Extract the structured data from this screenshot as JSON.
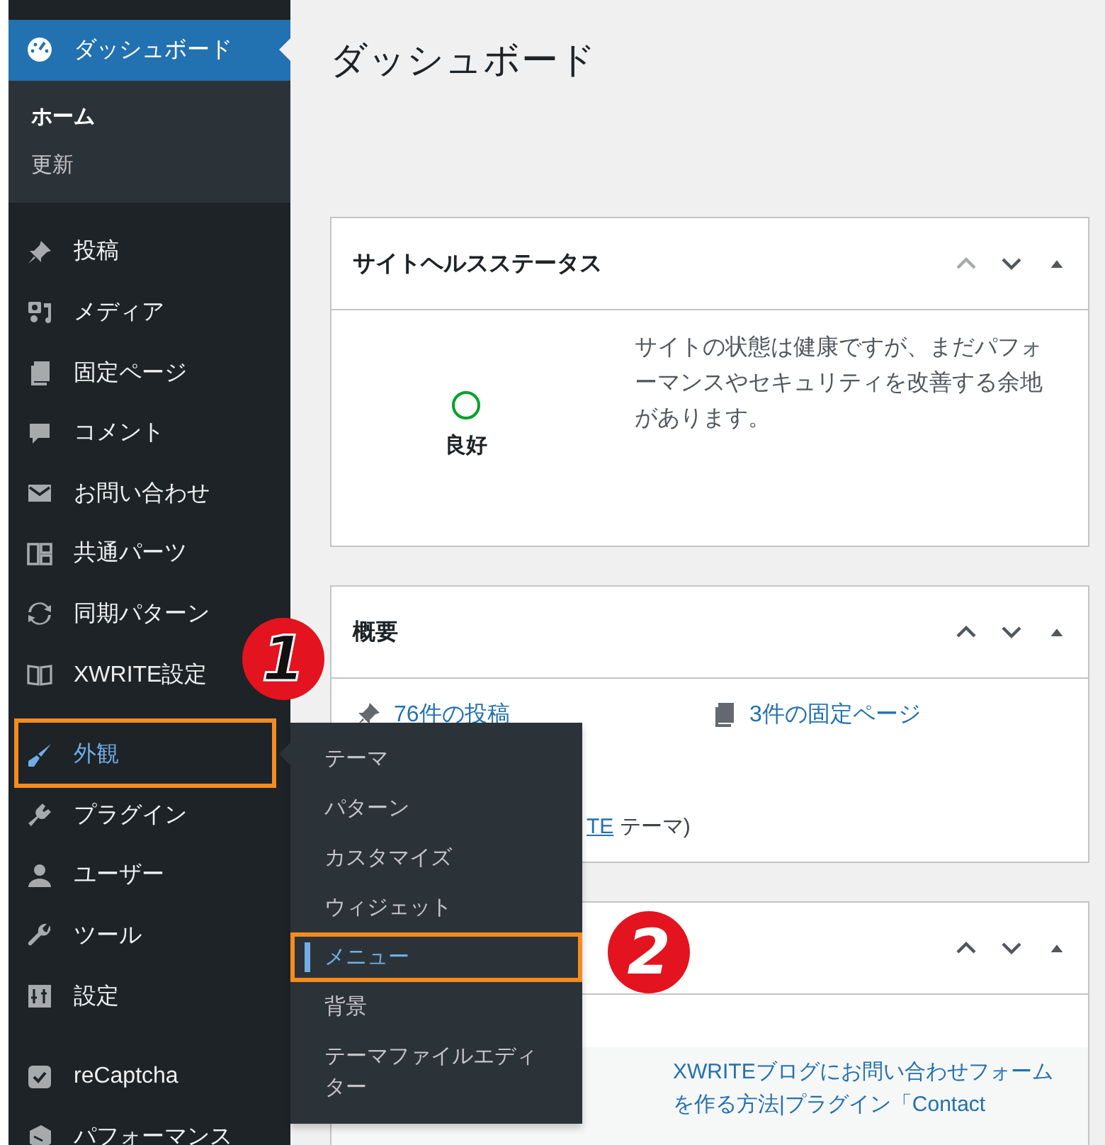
{
  "sidebar": {
    "groups": [
      [
        {
          "label": "ダッシュボード",
          "selected": true,
          "open": false,
          "highlighted": false,
          "submenu": [
            {
              "label": "ホーム",
              "selected": true
            },
            {
              "label": "更新",
              "selected": false
            }
          ]
        }
      ],
      [
        {
          "label": "投稿",
          "selected": false,
          "open": false,
          "highlighted": false
        },
        {
          "label": "メディア",
          "selected": false,
          "open": false,
          "highlighted": false
        },
        {
          "label": "固定ページ",
          "selected": false,
          "open": false,
          "highlighted": false
        },
        {
          "label": "コメント",
          "selected": false,
          "open": false,
          "highlighted": false
        },
        {
          "label": "お問い合わせ",
          "selected": false,
          "open": false,
          "highlighted": false
        },
        {
          "label": "共通パーツ",
          "selected": false,
          "open": false,
          "highlighted": false
        },
        {
          "label": "同期パターン",
          "selected": false,
          "open": false,
          "highlighted": false
        },
        {
          "label": "XWRITE設定",
          "selected": false,
          "open": false,
          "highlighted": false
        }
      ],
      [
        {
          "label": "外観",
          "selected": false,
          "open": true,
          "highlighted": true
        },
        {
          "label": "プラグイン",
          "selected": false,
          "open": false,
          "highlighted": false
        },
        {
          "label": "ユーザー",
          "selected": false,
          "open": false,
          "highlighted": false
        },
        {
          "label": "ツール",
          "selected": false,
          "open": false,
          "highlighted": false
        },
        {
          "label": "設定",
          "selected": false,
          "open": false,
          "highlighted": false
        }
      ],
      [
        {
          "label": "reCaptcha",
          "selected": false,
          "open": false,
          "highlighted": false
        },
        {
          "label": "パフォーマンス",
          "selected": false,
          "open": false,
          "highlighted": false
        }
      ]
    ]
  },
  "flyout_menu": {
    "items": [
      {
        "label": "テーマ",
        "selected": false,
        "highlighted": false
      },
      {
        "label": "パターン",
        "selected": false,
        "highlighted": false
      },
      {
        "label": "カスタマイズ",
        "selected": false,
        "highlighted": false
      },
      {
        "label": "ウィジェット",
        "selected": false,
        "highlighted": false
      },
      {
        "label": "メニュー",
        "selected": true,
        "highlighted": true
      },
      {
        "label": "背景",
        "selected": false,
        "highlighted": false
      },
      {
        "label": "テーマファイルエディター",
        "selected": false,
        "highlighted": false
      }
    ]
  },
  "page_title": "ダッシュボード",
  "site_health": {
    "title": "サイトヘルスステータス",
    "move_up_disabled": true,
    "status": "良好",
    "description": "サイトの状態は健康ですが、まだパフォーマンスやセキュリティを改善する余地があります。"
  },
  "overview": {
    "title": "概要",
    "move_up_disabled": false,
    "posts_link": "76件の投稿",
    "pages_link": "3件の固定ページ",
    "theme_link": "TE",
    "theme_suffix": " テーマ)"
  },
  "third_widget": {
    "move_up_disabled": false,
    "link": "XWRITEブログにお問い合わせフォームを作る方法|プラグイン「Contact"
  },
  "annotations": [
    {
      "kind": "outlined",
      "text": "1"
    },
    {
      "kind": "plain",
      "text": "2"
    }
  ]
}
